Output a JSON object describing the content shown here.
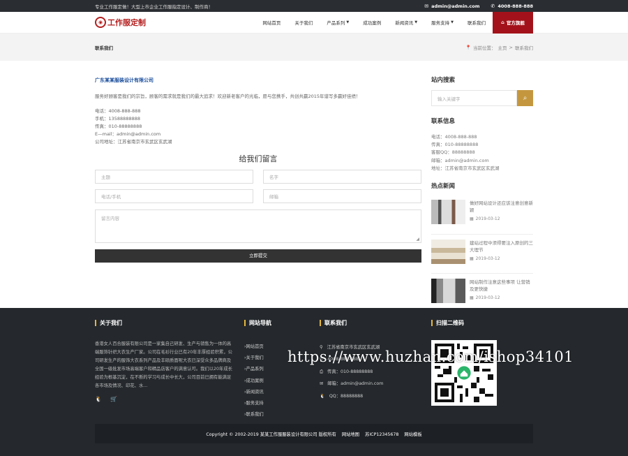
{
  "topbar": {
    "tagline": "专业工作服定做！大型上市企业工作服指定设计、制作商！",
    "email": "admin@admin.com",
    "phone": "4008-888-888"
  },
  "header": {
    "logo_text": "工作服定制",
    "nav": [
      {
        "label": "网站首页",
        "caret": false
      },
      {
        "label": "关于我们",
        "caret": false
      },
      {
        "label": "产品系列",
        "caret": true
      },
      {
        "label": "成功案例",
        "caret": false
      },
      {
        "label": "新闻资讯",
        "caret": true
      },
      {
        "label": "服务支持",
        "caret": true
      },
      {
        "label": "联系我们",
        "caret": false
      }
    ],
    "cta_label": "官方旗舰"
  },
  "crumb": {
    "page_title": "联系我们",
    "location_label": "当前位置：",
    "home": "主页",
    "sep": ">",
    "current": "联系我们"
  },
  "main": {
    "company": "广东某某服装设计有限公司",
    "desc": "服务好顾客是我们的宗旨，顾客的需求就是我们的最大追求！欢迎新老客户的光临，愿与您携手，共创共赢2015年谱写多赢好佳绩！",
    "contact": [
      "电话：4008-888-888",
      "手机：13588888888",
      "传真：010-88888888",
      "E—mail：admin@admin.com",
      "公司地址：江苏省南京市玄武区玄武湖"
    ],
    "form_title": "给我们留言",
    "placeholders": {
      "subject": "主题",
      "name": "名字",
      "phone": "电话/手机",
      "email": "邮箱",
      "message": "留言内容"
    },
    "submit": "立即提交"
  },
  "sidebar": {
    "search_title": "站内搜索",
    "search_placeholder": "输入关键字",
    "contact_title": "联系信息",
    "contact": [
      "电话：4008-888-888",
      "传真：010-88888888",
      "客服QQ：88888888",
      "邮箱：admin@admin.com",
      "地址：江苏省南京市玄武区玄武湖"
    ],
    "news_title": "热点新闻",
    "news": [
      {
        "title": "做好网站设计还应该注意创意新颖",
        "date": "2019-03-12"
      },
      {
        "title": "建站过程中须得要注入原创的三大理节",
        "date": "2019-03-12"
      },
      {
        "title": "网站制作注意这些事项 让营销及更快捷",
        "date": "2019-03-12"
      }
    ]
  },
  "footer": {
    "about_title": "关于我们",
    "about_text": "香港女人百合服装有限公司是一家集自己研发、生产与销售为一体的高端服饰针织大衣生产厂家。公司在毛衫行业已有20年丰厚经验积累，公司研发生产的服饰大衣系列产品及丰硕质面呢大衣已深受众多品牌商及全国一级批发市场高端客户和精品店客户的满意认可。我们以20年成长经验为根基沉淀，在不断的学习与成长中长大，公司目前已拥有能满足各市场及情况、印花、水...",
    "nav_title": "网站导航",
    "nav": [
      "网站首页",
      "关于我们",
      "产品系列",
      "成功案例",
      "新闻资讯",
      "服务支持",
      "联系我们"
    ],
    "contact_title": "联系我们",
    "contact": [
      {
        "icon": "location-icon",
        "text": "江苏省南京市玄武区玄武湖"
      },
      {
        "icon": "phone-icon",
        "text": "4008-888-888"
      },
      {
        "icon": "fax-icon",
        "text": "传真：010-88888888"
      },
      {
        "icon": "mail-icon",
        "text": "邮箱：admin@admin.com"
      },
      {
        "icon": "qq-icon",
        "text": "QQ：88888888"
      }
    ],
    "qr_title": "扫描二维码",
    "copyright": "Copyright © 2002-2019 某某工作服服装设计有限公司 版权所有",
    "links": [
      "网站地图",
      "苏ICP12345678",
      "网站模板"
    ]
  },
  "watermark": "https://www.huzhan.com/ishop34101"
}
